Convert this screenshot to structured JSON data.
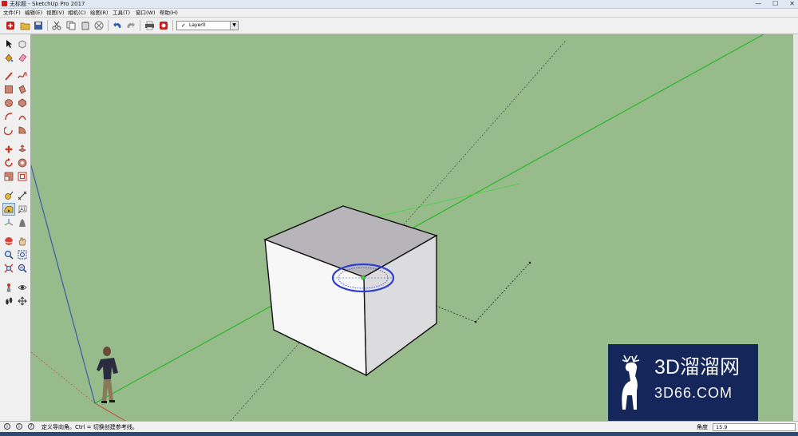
{
  "window": {
    "title": "无标题 - SketchUp Pro 2017",
    "minimize": "—",
    "maximize": "☐",
    "close": "✕"
  },
  "menu": [
    "文件(F)",
    "编辑(E)",
    "视图(V)",
    "相机(C)",
    "绘图(R)",
    "工具(T)",
    "窗口(W)",
    "帮助(H)"
  ],
  "toolbar": {
    "layer": {
      "check": "✓",
      "value": "Layer0"
    }
  },
  "status": {
    "hint": "定义导向角。Ctrl = 切换创建参考线。",
    "value_label": "角度",
    "value": "15.9"
  },
  "watermark": {
    "line1": "3D溜溜网",
    "line2": "3D66.COM"
  },
  "colors": {
    "viewport": "#98bb8c",
    "accent": "#c81e1e",
    "axis_green": "#29b829",
    "axis_blue": "#3a5aa8"
  }
}
